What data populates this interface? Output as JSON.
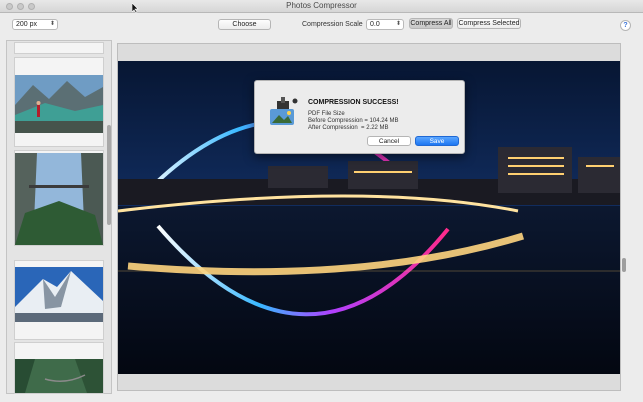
{
  "window": {
    "title": "Photos Compressor"
  },
  "toolbar": {
    "size_value": "200 px",
    "choose_label": "Choose",
    "scale_label": "Compression Scale",
    "scale_value": "0.0",
    "compress_all_label": "Compress All",
    "compress_selected_label": "Compress Selected",
    "help_label": "?"
  },
  "sheet": {
    "title": "COMPRESSION SUCCESS!",
    "subtitle": "PDF File Size",
    "before": "Before Compression = 104.24 MB",
    "after": "After Compression  = 2.22 MB",
    "cancel_label": "Cancel",
    "save_label": "Save"
  },
  "colors": {
    "accent": "#1d76f2"
  },
  "icons": [
    "app-compress-icon",
    "cursor-icon",
    "popup-arrows-icon",
    "help-icon"
  ]
}
